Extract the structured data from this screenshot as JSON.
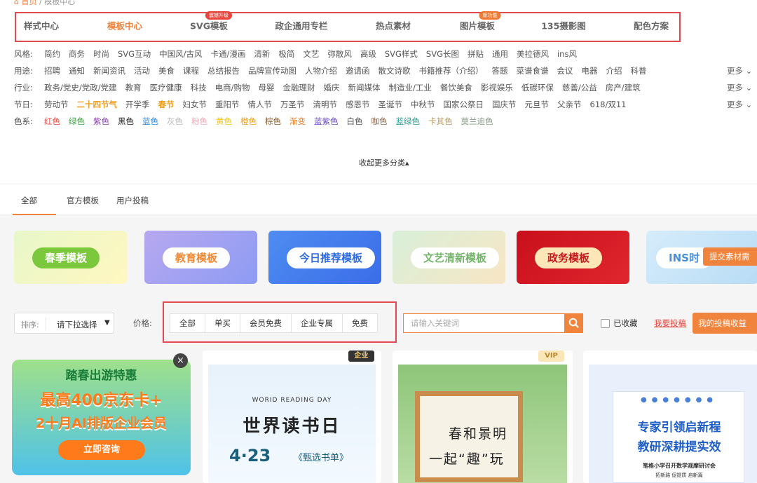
{
  "breadcrumb": {
    "home": "首页",
    "sep": "/",
    "current": "模板中心"
  },
  "nav": {
    "items": [
      "样式中心",
      "模板中心",
      "SVG模板",
      "政企通用专栏",
      "热点素材",
      "图片模板",
      "135摄影图",
      "配色方案"
    ],
    "badges": {
      "svg": "震撼升级",
      "image": "新功能"
    }
  },
  "filters": {
    "style": {
      "label": "风格:",
      "options": [
        "简约",
        "商务",
        "时尚",
        "SVG互动",
        "中国风/古风",
        "卡通/漫画",
        "清新",
        "极简",
        "文艺",
        "弥散风",
        "高级",
        "SVG样式",
        "SVG长图",
        "拼贴",
        "通用",
        "美拉德风",
        "ins风"
      ]
    },
    "use": {
      "label": "用途:",
      "options": [
        "招聘",
        "通知",
        "新闻资讯",
        "活动",
        "美食",
        "课程",
        "总结报告",
        "品牌宣传动图",
        "人物介绍",
        "邀请函",
        "散文诗歌",
        "书籍推荐（介绍）",
        "答题",
        "菜谱食谱",
        "会议",
        "电器",
        "介绍",
        "科普"
      ]
    },
    "industry": {
      "label": "行业:",
      "options": [
        "政务/党史/党政/党建",
        "教育",
        "医疗健康",
        "科技",
        "电商/购物",
        "母婴",
        "金融理财",
        "婚庆",
        "新闻媒体",
        "制造业/工业",
        "餐饮美食",
        "影视娱乐",
        "低碳环保",
        "慈善/公益",
        "房产/建筑"
      ]
    },
    "festival": {
      "label": "节日:",
      "options": [
        "劳动节",
        "二十四节气",
        "开学季",
        "春节",
        "妇女节",
        "重阳节",
        "情人节",
        "万圣节",
        "清明节",
        "感恩节",
        "圣诞节",
        "中秋节",
        "国家公祭日",
        "国庆节",
        "元旦节",
        "父亲节",
        "618/双11"
      ]
    },
    "color": {
      "label": "色系:",
      "options": [
        "红色",
        "绿色",
        "紫色",
        "黑色",
        "蓝色",
        "灰色",
        "粉色",
        "黄色",
        "橙色",
        "棕色",
        "渐变",
        "蓝紫色",
        "白色",
        "咖色",
        "蓝绿色",
        "卡其色",
        "莫兰迪色"
      ]
    },
    "more": "更多"
  },
  "collapse_label": "收起更多分类",
  "tabs": [
    "全部",
    "官方模板",
    "用户投稿"
  ],
  "banners": [
    "春季模板",
    "教育模板",
    "今日推荐模板",
    "文艺清新模板",
    "政务模板",
    "INS时"
  ],
  "submit_material": "提交素材需",
  "toolbar": {
    "sort_label": "排序:",
    "sort_value": "请下拉选择",
    "price_label": "价格:",
    "price_options": [
      "全部",
      "单买",
      "会员免费",
      "企业专属",
      "免费"
    ],
    "search_placeholder": "请输入关键词",
    "favorites": "已收藏",
    "contribute": "我要投稿",
    "earnings": "我的投稿收益"
  },
  "ad": {
    "line1": "踏春出游特惠",
    "line2": "最高400京东卡+",
    "line3": "2十月AI排版企业会员",
    "button": "立即咨询"
  },
  "cards": {
    "c1": {
      "tag": "企业",
      "sub": "WORID READING DAY",
      "title": "世界读书日",
      "date": "4·23",
      "book": "《甄选书单》"
    },
    "c2": {
      "tag": "VIP",
      "line1": "春和景明",
      "line2": "一起“趣”玩"
    },
    "c3": {
      "line1": "专家引领启新程",
      "line2": "教研深耕提实效",
      "line3": "笔格小学召开数学观摩研讨会",
      "line4": "拓新路 促提质 启新篇"
    }
  },
  "colors": {
    "accent": "#f0843c",
    "highlight_box": "#e04a50",
    "swatches": [
      "#e8453c",
      "#3aa53a",
      "#8e44ad",
      "#222222",
      "#2e86de",
      "#bbbbbb",
      "#f4a7b9",
      "#f1c40f",
      "#f39c12",
      "#8b5a2b",
      "#e67e22",
      "#6a4cc4",
      "#555555",
      "#8b6a4f",
      "#2a9d8f",
      "#b79c6b",
      "#8a9a8a"
    ]
  }
}
